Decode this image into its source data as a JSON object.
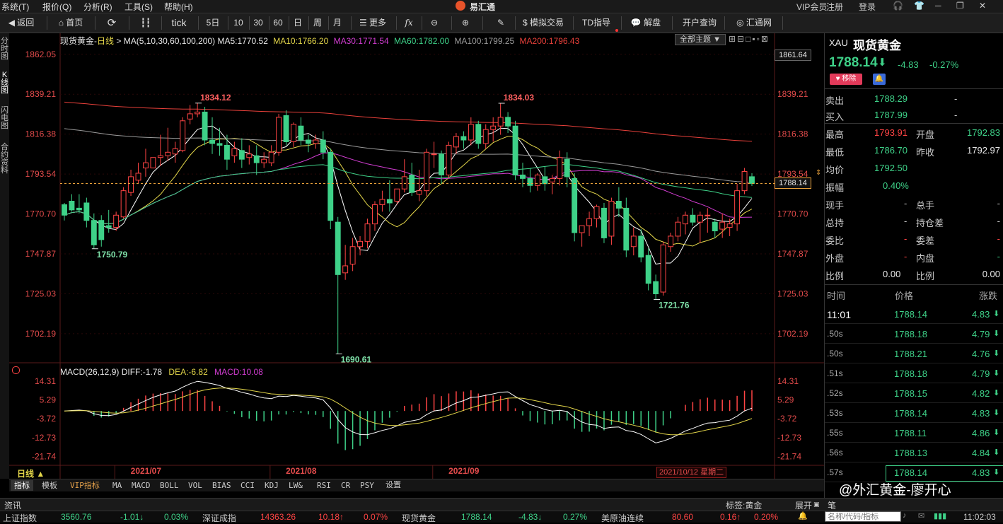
{
  "menu": {
    "items": [
      "系统(T)",
      "报价(Q)",
      "分析(R)",
      "工具(S)",
      "帮助(H)"
    ],
    "app_title": "易汇通",
    "vip": "VIP会员",
    "register": "注册",
    "login": "登录"
  },
  "toolbar": {
    "back": "返回",
    "home": "首页",
    "tick": "tick",
    "periods": [
      "5日",
      "10",
      "30",
      "60",
      "日",
      "周",
      "月"
    ],
    "more": "更多",
    "sim_trade": "模拟交易",
    "td": "TD指导",
    "analysis": "解盘",
    "account": "开户查询",
    "huitong": "汇通网"
  },
  "left_tabs": [
    "分时图",
    "K线图",
    "闪电图",
    "合约资料"
  ],
  "chart_header": {
    "name": "现货黄金",
    "period": "日线",
    "ma_params": "MA(5,10,30,60,100,200)",
    "ma5": "MA5:1770.52",
    "ma10": "MA10:1766.20",
    "ma30": "MA30:1771.54",
    "ma60": "MA60:1782.00",
    "ma100": "MA100:1799.25",
    "ma200": "MA200:1796.43",
    "theme": "全部主题"
  },
  "colors": {
    "up": "#ff4444",
    "down": "#3ed188",
    "ma5": "#ffffff",
    "ma10": "#e3d64a",
    "ma30": "#d23dd2",
    "ma60": "#3ed188",
    "ma100": "#9a9a9a",
    "ma200": "#e8403a",
    "price_line": "#e8a03a"
  },
  "price_axis": {
    "labels": [
      "1862.05",
      "1839.21",
      "1816.38",
      "1793.54",
      "1770.70",
      "1747.87",
      "1725.03",
      "1702.19"
    ],
    "top_box": "1861.64",
    "current_box": "1788.14"
  },
  "annotations": {
    "hi1": "1834.12",
    "hi2": "1834.03",
    "lo1": "1750.79",
    "lo2": "1690.61",
    "lo3": "1721.76"
  },
  "macd_header": {
    "label": "MACD(26,12,9)",
    "diff": "DIFF:-1.78",
    "dea": "DEA:-6.82",
    "macd": "MACD:10.08"
  },
  "macd_axis": {
    "labels": [
      "14.31",
      "5.29",
      "-3.72",
      "-12.73",
      "-21.74"
    ]
  },
  "date_axis": {
    "labels": [
      "2021/07",
      "2021/08",
      "2021/09"
    ],
    "current": "2021/10/12 星期二",
    "period_btn": "日线 ▲"
  },
  "bottom_tabs": [
    "指标",
    "模板",
    "VIP指标",
    "MA",
    "MACD",
    "BOLL",
    "VOL",
    "BIAS",
    "CCI",
    "KDJ",
    "LW&",
    "RSI",
    "CR",
    "PSY",
    "设置"
  ],
  "quote": {
    "code": "XAU",
    "name": "现货黄金",
    "price": "1788.14",
    "arrow": "⬇",
    "change": "-4.83",
    "pct": "-0.27%",
    "remove": "移除",
    "sell_label": "卖出",
    "sell": "1788.29",
    "sell_dash": "-",
    "buy_label": "买入",
    "buy": "1787.99",
    "buy_dash": "-",
    "high_label": "最高",
    "high": "1793.91",
    "open_label": "开盘",
    "open": "1792.83",
    "low_label": "最低",
    "low": "1786.70",
    "prev_label": "昨收",
    "prev": "1792.97",
    "avg_label": "均价",
    "avg": "1792.50",
    "amp_label": "振幅",
    "amp": "0.40%",
    "cur_hand_label": "现手",
    "cur_hand": "-",
    "tot_hand_label": "总手",
    "tot_hand": "-",
    "tot_hold_label": "总持",
    "tot_hold": "-",
    "hold_label": "持仓差",
    "hold": "-",
    "wb_label": "委比",
    "wb": "-",
    "wc_label": "委差",
    "wc": "-",
    "outer_label": "外盘",
    "outer": "-",
    "inner_label": "内盘",
    "inner": "-",
    "ratio1_label": "比例",
    "ratio1": "0.00",
    "ratio2_label": "比例",
    "ratio2": "0.00"
  },
  "ticks": {
    "headers": [
      "时间",
      "价格",
      "涨跌"
    ],
    "rows": [
      {
        "t": "11:01",
        "p": "1788.14",
        "c": "4.83"
      },
      {
        "t": ".50s",
        "p": "1788.18",
        "c": "4.79"
      },
      {
        "t": ".50s",
        "p": "1788.21",
        "c": "4.76"
      },
      {
        "t": ".51s",
        "p": "1788.18",
        "c": "4.79"
      },
      {
        "t": ".52s",
        "p": "1788.15",
        "c": "4.82"
      },
      {
        "t": ".53s",
        "p": "1788.14",
        "c": "4.83"
      },
      {
        "t": ".55s",
        "p": "1788.11",
        "c": "4.86"
      },
      {
        "t": ".56s",
        "p": "1788.13",
        "c": "4.84"
      },
      {
        "t": ".57s",
        "p": "1788.14",
        "c": "4.83"
      }
    ]
  },
  "watermark": "@外汇黄金-廖开心",
  "info_bar": {
    "label": "资讯",
    "tag": "标签:黄金",
    "expand": "展开",
    "pen": "笔"
  },
  "ticker": {
    "items": [
      {
        "name": "上证指数",
        "val": "3560.76",
        "chg": "-1.01↓",
        "pct": "0.03%"
      },
      {
        "name": "深证成指",
        "val": "14363.26",
        "chg": "10.18↑",
        "pct": "0.07%"
      },
      {
        "name": "现货黄金",
        "val": "1788.14",
        "chg": "-4.83↓",
        "pct": "0.27%"
      },
      {
        "name": "美原油连续",
        "val": "80.60",
        "chg": "0.16↑",
        "pct": "0.20%"
      }
    ],
    "search_placeholder": "名称/代码/指标",
    "time": "11:02:03"
  },
  "chart_data": {
    "type": "candlestick",
    "title": "现货黄金 日线",
    "y_range": [
      1690,
      1866
    ],
    "candles": [
      [
        1776,
        1777,
        1770,
        1767
      ],
      [
        1778,
        1782,
        1773,
        1772
      ],
      [
        1774,
        1782,
        1773,
        1771
      ],
      [
        1777,
        1780,
        1767,
        1763
      ],
      [
        1767,
        1771,
        1753,
        1750.79
      ],
      [
        1767,
        1770,
        1756,
        1752
      ],
      [
        1764,
        1773,
        1763,
        1760
      ],
      [
        1763,
        1772,
        1770,
        1761
      ],
      [
        1769,
        1786,
        1784,
        1768
      ],
      [
        1783,
        1796,
        1792,
        1781
      ],
      [
        1790,
        1800,
        1794,
        1788
      ],
      [
        1797,
        1808,
        1800,
        1792
      ],
      [
        1797,
        1803,
        1803,
        1797
      ],
      [
        1803,
        1816,
        1804,
        1798
      ],
      [
        1804,
        1820,
        1806,
        1801
      ],
      [
        1805,
        1812,
        1808,
        1800
      ],
      [
        1807,
        1826,
        1824,
        1806
      ],
      [
        1825,
        1833,
        1828,
        1822
      ],
      [
        1828,
        1834.12,
        1829,
        1826
      ],
      [
        1829,
        1832,
        1813,
        1810
      ],
      [
        1813,
        1826,
        1811,
        1805
      ],
      [
        1811,
        1820,
        1810,
        1804
      ],
      [
        1810,
        1816,
        1802,
        1796
      ],
      [
        1804,
        1812,
        1808,
        1800
      ],
      [
        1807,
        1814,
        1802,
        1797
      ],
      [
        1803,
        1810,
        1805,
        1799
      ],
      [
        1804,
        1810,
        1800,
        1793
      ],
      [
        1800,
        1806,
        1802,
        1797
      ],
      [
        1800,
        1810,
        1806,
        1798
      ],
      [
        1806,
        1828,
        1826,
        1804
      ],
      [
        1827,
        1830,
        1812,
        1810
      ],
      [
        1812,
        1823,
        1822,
        1809
      ],
      [
        1821,
        1826,
        1813,
        1810
      ],
      [
        1813,
        1816,
        1811,
        1806
      ],
      [
        1811,
        1816,
        1813,
        1808
      ],
      [
        1813,
        1818,
        1806,
        1802
      ],
      [
        1806,
        1808,
        1767,
        1762
      ],
      [
        1766,
        1769,
        1736,
        1690.61
      ],
      [
        1737,
        1753,
        1741,
        1733
      ],
      [
        1742,
        1757,
        1752,
        1738
      ],
      [
        1752,
        1758,
        1755,
        1747
      ],
      [
        1755,
        1768,
        1765,
        1751
      ],
      [
        1765,
        1778,
        1776,
        1761
      ],
      [
        1776,
        1784,
        1779,
        1772
      ],
      [
        1779,
        1790,
        1777,
        1772
      ],
      [
        1778,
        1784,
        1785,
        1776
      ],
      [
        1785,
        1802,
        1792,
        1783
      ],
      [
        1793,
        1800,
        1783,
        1781
      ],
      [
        1782,
        1796,
        1784,
        1778
      ],
      [
        1784,
        1808,
        1806,
        1781
      ],
      [
        1805,
        1812,
        1805,
        1797
      ],
      [
        1805,
        1807,
        1793,
        1788
      ],
      [
        1793,
        1812,
        1810,
        1791
      ],
      [
        1809,
        1817,
        1815,
        1805
      ],
      [
        1815,
        1818,
        1813,
        1808
      ],
      [
        1813,
        1826,
        1822,
        1810
      ],
      [
        1822,
        1824,
        1811,
        1808
      ],
      [
        1811,
        1822,
        1819,
        1808
      ],
      [
        1819,
        1826,
        1821,
        1812
      ],
      [
        1821,
        1834.03,
        1826,
        1816
      ],
      [
        1826,
        1829,
        1821,
        1817
      ],
      [
        1821,
        1824,
        1793,
        1790
      ],
      [
        1793,
        1800,
        1791,
        1786
      ],
      [
        1791,
        1797,
        1787,
        1783
      ],
      [
        1787,
        1794,
        1793,
        1784
      ],
      [
        1792,
        1798,
        1788,
        1784
      ],
      [
        1789,
        1793,
        1791,
        1782
      ],
      [
        1791,
        1807,
        1803,
        1787
      ],
      [
        1802,
        1806,
        1792,
        1786
      ],
      [
        1791,
        1794,
        1760,
        1755
      ],
      [
        1760,
        1764,
        1764,
        1752
      ],
      [
        1764,
        1772,
        1768,
        1758
      ],
      [
        1768,
        1776,
        1775,
        1763
      ],
      [
        1774,
        1777,
        1757,
        1754
      ],
      [
        1758,
        1780,
        1778,
        1753
      ],
      [
        1778,
        1786,
        1774,
        1769
      ],
      [
        1774,
        1780,
        1750,
        1746
      ],
      [
        1752,
        1763,
        1758,
        1747
      ],
      [
        1758,
        1762,
        1746,
        1743
      ],
      [
        1747,
        1751,
        1731,
        1727
      ],
      [
        1732,
        1736,
        1725,
        1721.76
      ],
      [
        1726,
        1755,
        1753,
        1724
      ],
      [
        1752,
        1760,
        1758,
        1749
      ],
      [
        1758,
        1769,
        1766,
        1755
      ],
      [
        1765,
        1772,
        1770,
        1759
      ],
      [
        1770,
        1774,
        1766,
        1764
      ],
      [
        1766,
        1772,
        1770,
        1754
      ],
      [
        1770,
        1774,
        1770,
        1760
      ],
      [
        1766,
        1768,
        1761,
        1757
      ],
      [
        1762,
        1771,
        1766,
        1757
      ],
      [
        1763,
        1768,
        1765,
        1758
      ],
      [
        1765,
        1788,
        1784,
        1761
      ],
      [
        1784,
        1797,
        1795,
        1782
      ],
      [
        1792,
        1794,
        1788.14,
        1786.7
      ]
    ],
    "candle_format": [
      "open",
      "high",
      "close",
      "low"
    ],
    "macd": {
      "diff": -1.78,
      "dea": -6.82,
      "macd": 10.08,
      "y_range": [
        -25,
        17
      ]
    }
  }
}
